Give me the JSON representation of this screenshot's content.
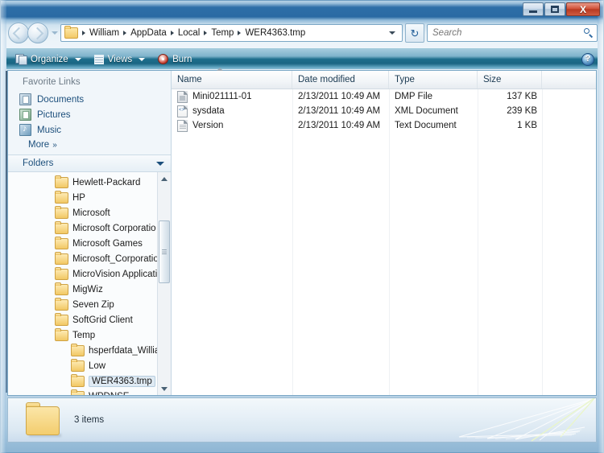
{
  "window": {
    "controls": {
      "minimize": "minimize-button",
      "maximize": "maximize-button",
      "close_label": "X"
    }
  },
  "address_bar": {
    "crumbs": [
      {
        "label": "William"
      },
      {
        "label": "AppData"
      },
      {
        "label": "Local"
      },
      {
        "label": "Temp"
      },
      {
        "label": "WER4363.tmp"
      }
    ],
    "refresh_glyph": "↻"
  },
  "search": {
    "placeholder": "Search",
    "value": ""
  },
  "toolbar": {
    "organize_label": "Organize",
    "views_label": "Views",
    "burn_label": "Burn",
    "help_label": "?"
  },
  "sidebar": {
    "favorites_title": "Favorite Links",
    "favorites": [
      {
        "label": "Documents",
        "icon": "documents-icon"
      },
      {
        "label": "Pictures",
        "icon": "pictures-icon"
      },
      {
        "label": "Music",
        "icon": "music-icon"
      }
    ],
    "more_label": "More",
    "more_chevron": "»",
    "folders_label": "Folders",
    "tree": [
      {
        "label": "Hewlett-Packard",
        "indent": 0,
        "selected": false
      },
      {
        "label": "HP",
        "indent": 0,
        "selected": false
      },
      {
        "label": "Microsoft",
        "indent": 0,
        "selected": false
      },
      {
        "label": "Microsoft Corporatio",
        "indent": 0,
        "selected": false
      },
      {
        "label": "Microsoft Games",
        "indent": 0,
        "selected": false
      },
      {
        "label": "Microsoft_Corporatio",
        "indent": 0,
        "selected": false
      },
      {
        "label": "MicroVision Applicati",
        "indent": 0,
        "selected": false
      },
      {
        "label": "MigWiz",
        "indent": 0,
        "selected": false
      },
      {
        "label": "Seven Zip",
        "indent": 0,
        "selected": false
      },
      {
        "label": "SoftGrid Client",
        "indent": 0,
        "selected": false
      },
      {
        "label": "Temp",
        "indent": 0,
        "selected": false
      },
      {
        "label": "hsperfdata_William",
        "indent": 1,
        "selected": false
      },
      {
        "label": "Low",
        "indent": 1,
        "selected": false
      },
      {
        "label": "WER4363.tmp",
        "indent": 1,
        "selected": true
      },
      {
        "label": "WPDNSE",
        "indent": 1,
        "selected": false
      }
    ]
  },
  "file_list": {
    "columns": [
      {
        "key": "name",
        "label": "Name"
      },
      {
        "key": "date",
        "label": "Date modified"
      },
      {
        "key": "type",
        "label": "Type"
      },
      {
        "key": "size",
        "label": "Size"
      }
    ],
    "sorted_by": "Name",
    "rows": [
      {
        "name": "Mini021111-01",
        "date": "2/13/2011 10:49 AM",
        "type": "DMP File",
        "size": "137 KB",
        "icon": "dmp-file-icon"
      },
      {
        "name": "sysdata",
        "date": "2/13/2011 10:49 AM",
        "type": "XML Document",
        "size": "239 KB",
        "icon": "xml-file-icon"
      },
      {
        "name": "Version",
        "date": "2/13/2011 10:49 AM",
        "type": "Text Document",
        "size": "1 KB",
        "icon": "text-file-icon"
      }
    ]
  },
  "status_bar": {
    "item_count": "3 items"
  },
  "colors": {
    "accent": "#1e6e8c",
    "link": "#1c4f7c",
    "close_button": "#c0392b",
    "folder": "#f2c864"
  }
}
